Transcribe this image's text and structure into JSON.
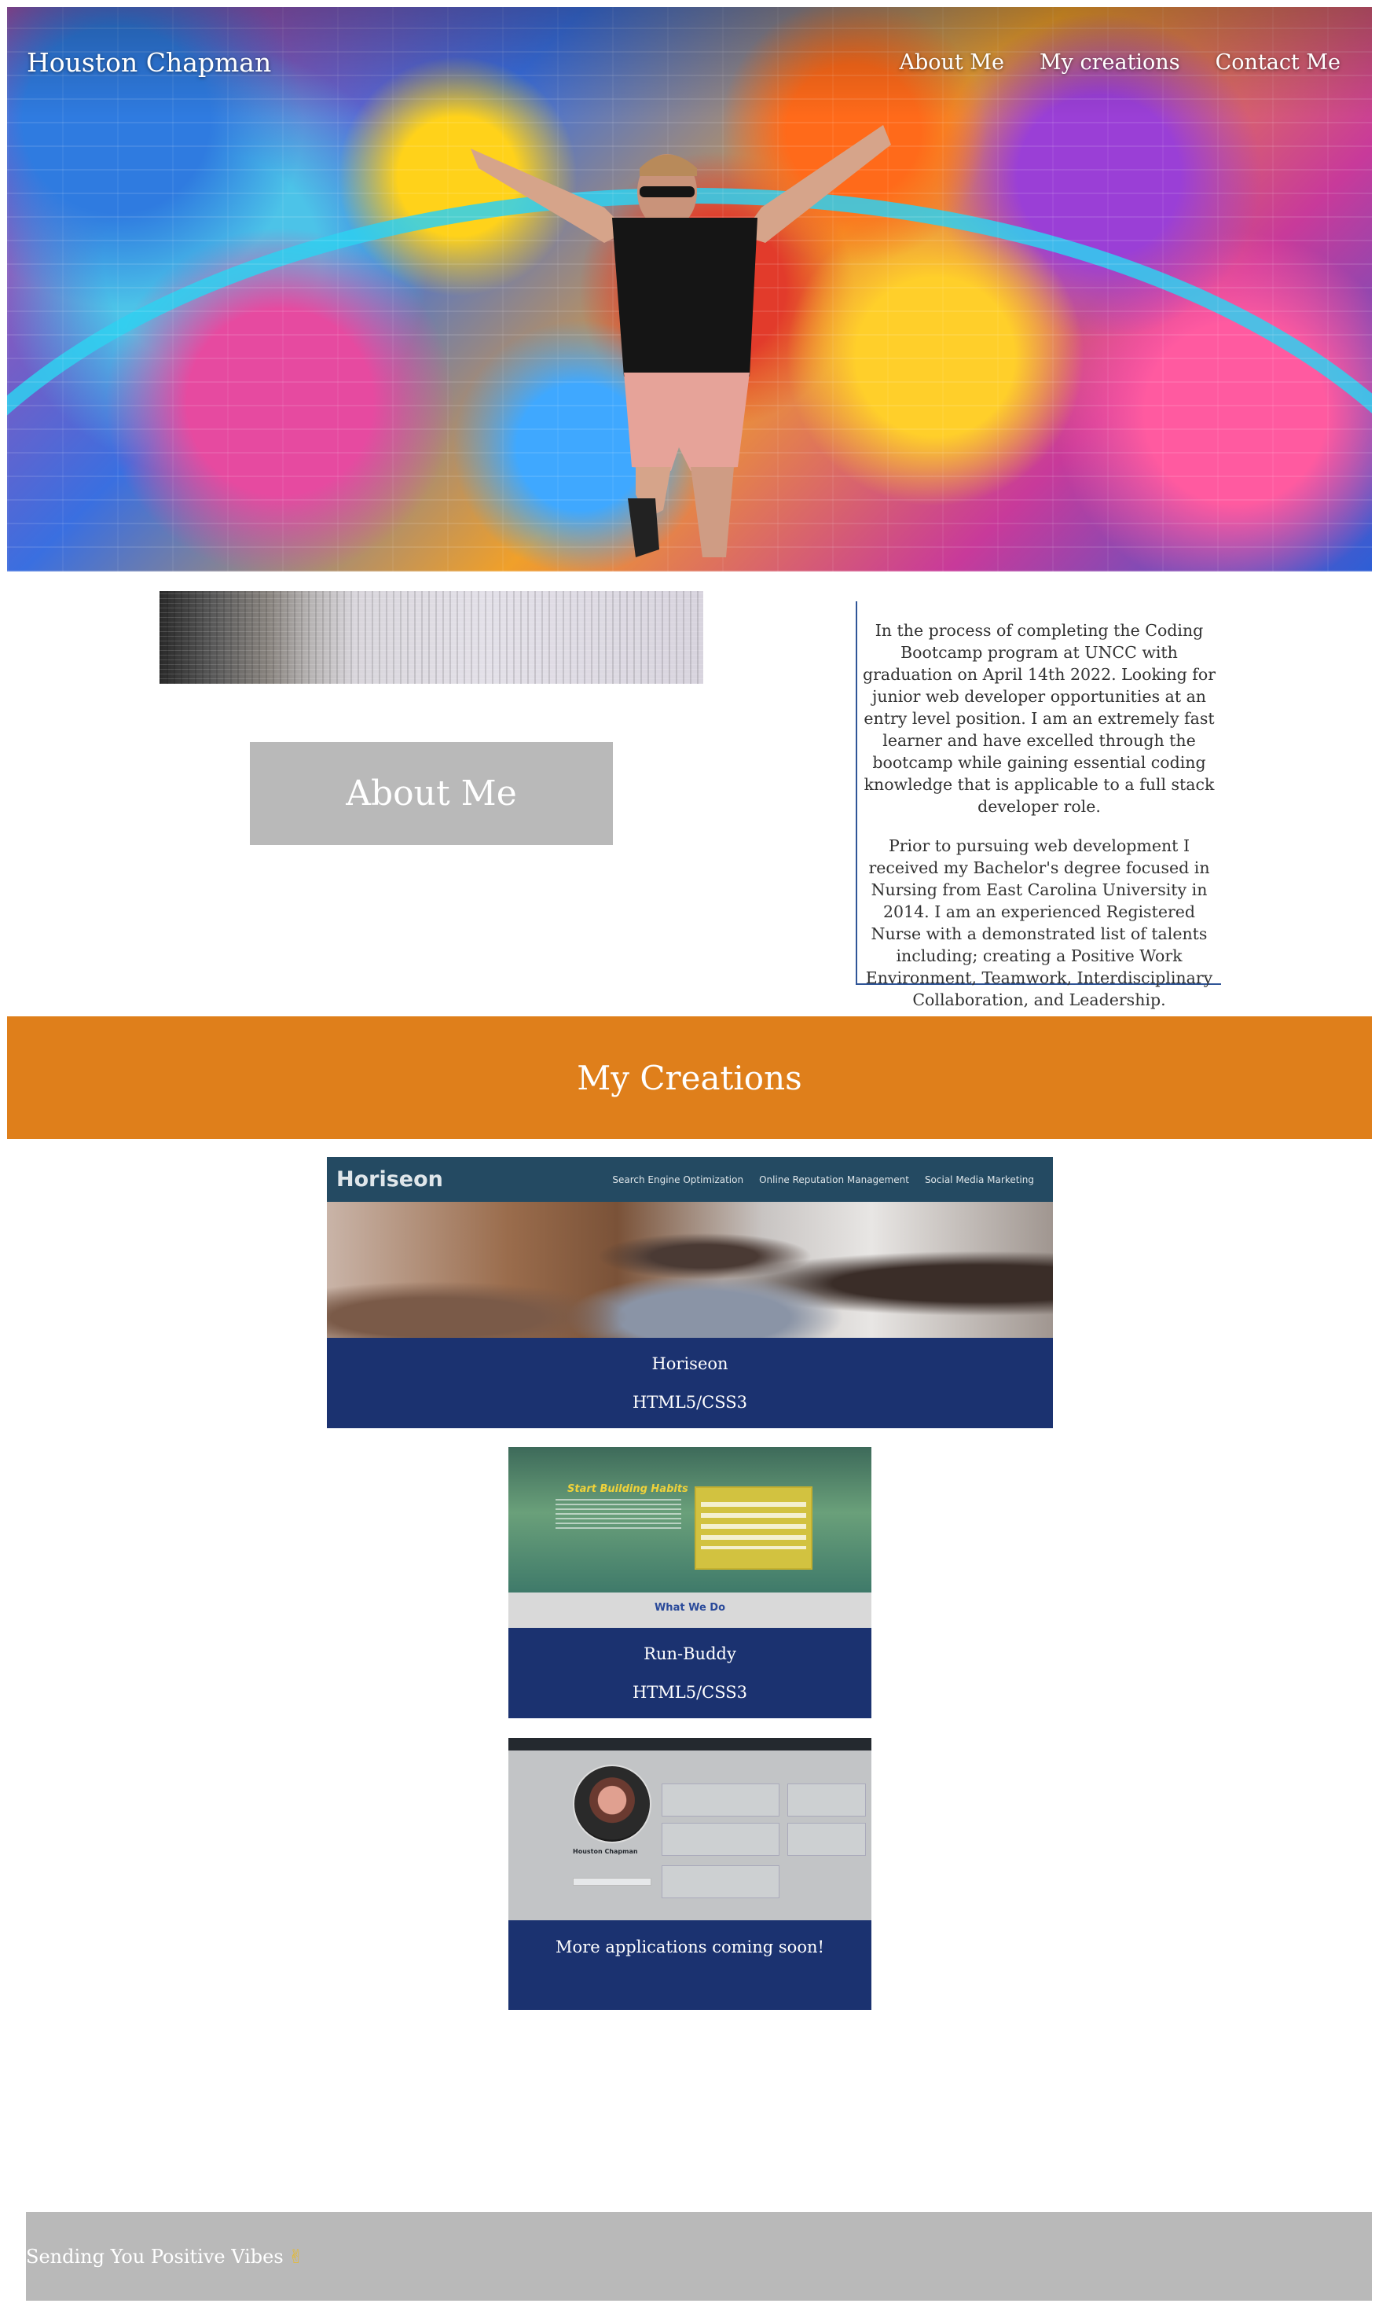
{
  "header": {
    "brand": "Houston Chapman",
    "nav": [
      "About Me",
      "My creations",
      "Contact Me"
    ]
  },
  "about": {
    "heading": "About Me",
    "paragraphs": [
      "In the process of completing the Coding Bootcamp program at UNCC with graduation on April 14th 2022. Looking for junior web developer opportunities at an entry level position. I am an extremely fast learner and have excelled through the bootcamp while gaining essential coding knowledge that is applicable to a full stack developer role.",
      "Prior to pursuing web development I received my Bachelor's degree focused in Nursing from East Carolina University in 2014. I am an experienced Registered Nurse with a demonstrated list of talents including; creating a Positive Work Environment, Teamwork, Interdisciplinary Collaboration, and Leadership."
    ]
  },
  "creations": {
    "heading": "My Creations",
    "projects": [
      {
        "name": "Horiseon",
        "tech": "HTML5/CSS3",
        "screenshot": {
          "logo": "Horiseon",
          "nav": [
            "Search Engine Optimization",
            "Online Reputation Management",
            "Social Media Marketing"
          ]
        }
      },
      {
        "name": "Run-Buddy",
        "tech": "HTML5/CSS3",
        "screenshot": {
          "title": "Start Building Habits",
          "section": "What We Do"
        }
      },
      {
        "name": "More applications coming soon!",
        "screenshot": {
          "profile_name": "Houston Chapman"
        }
      }
    ]
  },
  "footer": {
    "text": "Sending You Positive Vibes",
    "icon": "✌"
  },
  "colors": {
    "accent_orange": "#df7f1b",
    "card_navy": "#1b3270",
    "gray_box": "#b9b9b9",
    "about_border": "#2f5597"
  }
}
